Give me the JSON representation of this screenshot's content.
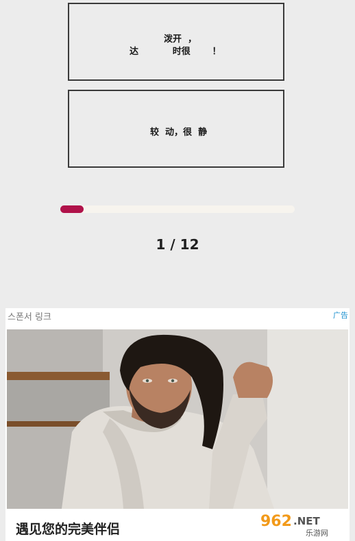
{
  "cards": [
    {
      "line1": "泼开  ，",
      "line2": "达           时很       ！"
    },
    {
      "line1": "较  动，很  静"
    }
  ],
  "progress": {
    "fraction": 0.1,
    "color": "#b0124a"
  },
  "counter": "1 / 12",
  "ad": {
    "sponsor_label": "스폰서 링크",
    "ad_tag": "广告",
    "headline": "遇见您的完美伴侣",
    "watermark_text": "962.NET",
    "watermark_subtext": "乐游网"
  }
}
